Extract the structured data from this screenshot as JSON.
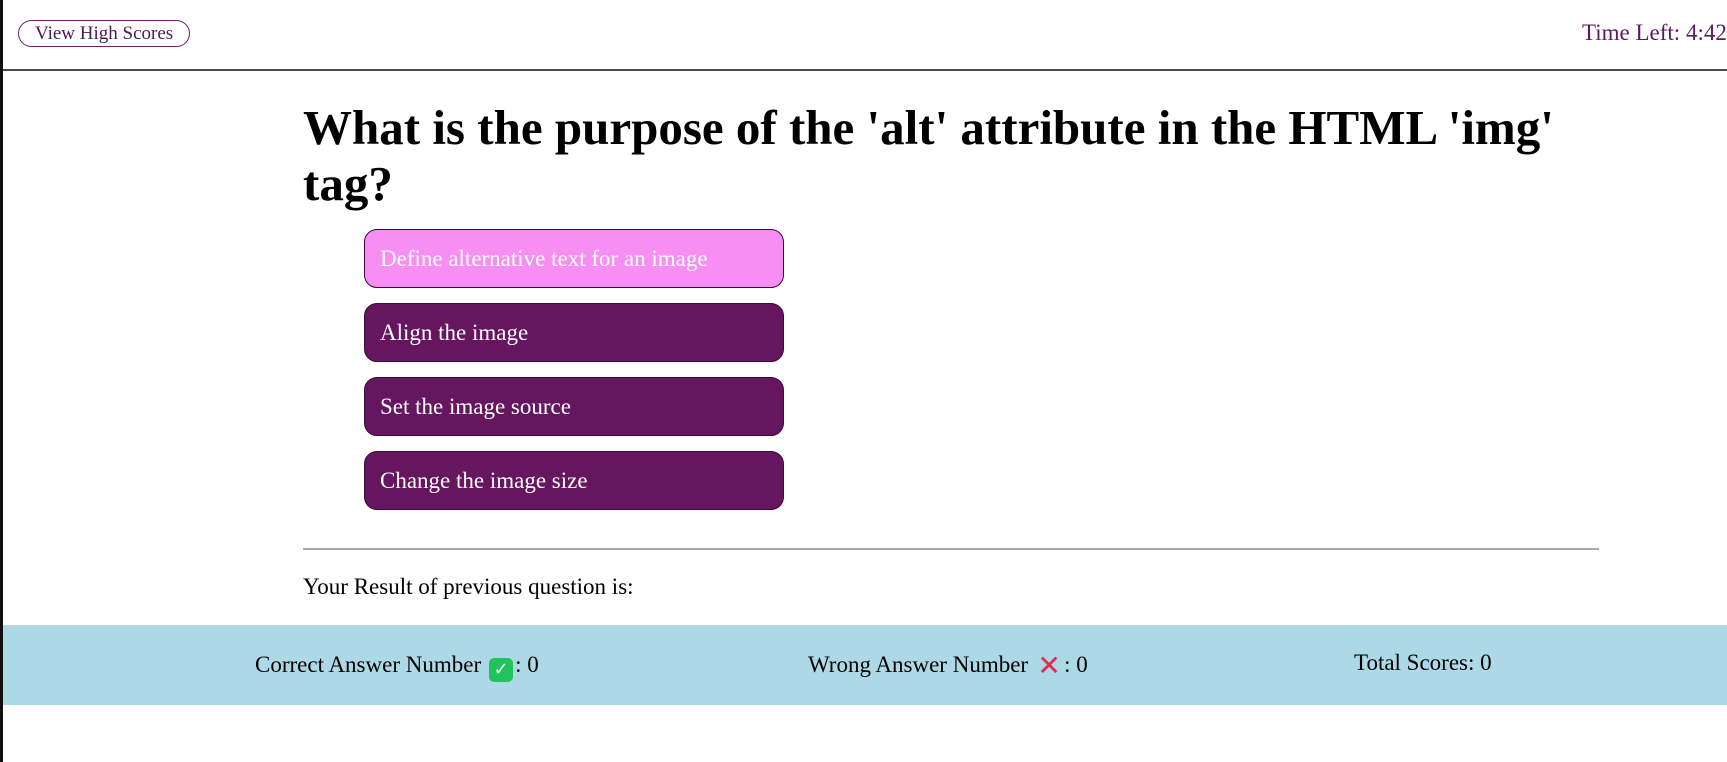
{
  "header": {
    "high_scores_label": "View High Scores",
    "timer_label": "Time Left: ",
    "timer_value": "4:42"
  },
  "question": {
    "text": "What is the purpose of the 'alt' attribute in the HTML 'img' tag?"
  },
  "answers": [
    {
      "label": "Define alternative text for an image",
      "selected": true
    },
    {
      "label": "Align the image",
      "selected": false
    },
    {
      "label": "Set the image source",
      "selected": false
    },
    {
      "label": "Change the image size",
      "selected": false
    }
  ],
  "result": {
    "label": "Your Result of previous question is:"
  },
  "scores": {
    "correct_label": "Correct Answer Number",
    "correct_icon": "check-mark-icon",
    "correct_value": ": 0",
    "wrong_label": "Wrong Answer Number",
    "wrong_icon": "cross-mark-icon",
    "wrong_value": ": 0",
    "total_label": "Total Scores: 0"
  },
  "colors": {
    "answer_bg": "#66155f",
    "answer_selected_bg": "#f78ef4",
    "score_bar_bg": "#add8e6",
    "accent_text": "#5b1a60",
    "check_green": "#21c45a",
    "cross_red": "#e8264e"
  }
}
